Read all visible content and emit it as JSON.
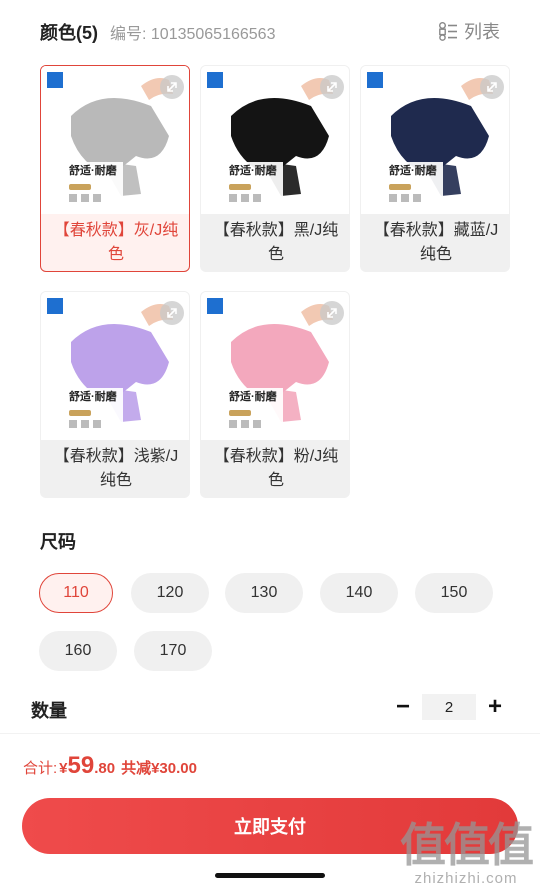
{
  "header": {
    "color_title": "颜色(5)",
    "code_label": "编号: 10135065166563",
    "list_label": "列表"
  },
  "colors": [
    {
      "label": "【春秋款】灰/J纯色",
      "swatch": "#b9b9b9",
      "selected": true,
      "badge_text": "舒适·耐磨"
    },
    {
      "label": "【春秋款】黑/J纯色",
      "swatch": "#141414",
      "selected": false,
      "badge_text": "舒适·耐磨"
    },
    {
      "label": "【春秋款】藏蓝/J纯色",
      "swatch": "#1f2a4e",
      "selected": false,
      "badge_text": "舒适·耐磨"
    },
    {
      "label": "【春秋款】浅紫/J纯色",
      "swatch": "#bda2ea",
      "selected": false,
      "badge_text": "舒适·耐磨"
    },
    {
      "label": "【春秋款】粉/J纯色",
      "swatch": "#f3a8bd",
      "selected": false,
      "badge_text": "舒适·耐磨"
    }
  ],
  "size": {
    "title": "尺码",
    "options": [
      "110",
      "120",
      "130",
      "140",
      "150",
      "160",
      "170"
    ],
    "selected": "110"
  },
  "quantity": {
    "title": "数量",
    "minus": "−",
    "value": "2",
    "plus": "+"
  },
  "total": {
    "label": "合计:",
    "yen": "¥",
    "amount_int": "59",
    "amount_dec": ".80",
    "savings": "共减¥30.00"
  },
  "pay_button": "立即支付",
  "watermark": {
    "big": "值值值",
    "small": "zhizhizhi.com"
  },
  "accent_color": "#e0453a"
}
